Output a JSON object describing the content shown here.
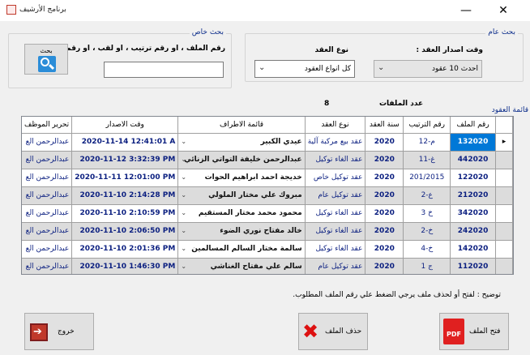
{
  "window": {
    "title": "برنامج الأرشيف",
    "minimize_glyph": "—",
    "close_glyph": "✕"
  },
  "special_search": {
    "title": "بحث خاص",
    "prompt": "رقم الملف ، او رقم ترتيب ، او لقب ، او رقم هاتف :",
    "input_value": "",
    "button_label": "بحث",
    "icon": "search-icon"
  },
  "general_search": {
    "title": "بحث عام",
    "issue_time_label": "وقت اصدار العقد :",
    "issue_time_value": "احدث 10 عقود",
    "contract_type_label": "نوع العقد",
    "contract_type_value": "كل انواع العقود"
  },
  "files_count": {
    "label": "عدد الملفات",
    "value": "8"
  },
  "contracts_list_label": "قائمة العقود",
  "grid": {
    "columns": [
      "رقم الملف",
      "رقم الترتيب",
      "سنة العقد",
      "نوع العقد",
      "قائمة الاطراف",
      "وقت الاصدار",
      "تحرير الموظف"
    ],
    "rows": [
      {
        "file": "132020",
        "seq": "م-12",
        "year": "2020",
        "type": "عقد بيع مركبة آلية",
        "parties": "عيدي الكبير",
        "date": "2020-11-14 12:41:01 A",
        "editor": "عبدالرحمن الع"
      },
      {
        "file": "442020",
        "seq": "غ-11",
        "year": "2020",
        "type": "عقد الغاء توكيل",
        "parties": "عبدالرحمن خليفة التواتي الزنائي",
        "date": "2020-11-12 3:32:39 PM",
        "editor": "عبدالرحمن الع"
      },
      {
        "file": "122020",
        "seq": "201/2015",
        "year": "2020",
        "type": "عقد توكيل خاص",
        "parties": "خديجة احمد ابراهيم الحوات",
        "date": "2020-11-11 12:01:00 PM",
        "editor": "عبدالرحمن الع"
      },
      {
        "file": "212020",
        "seq": "ع-2",
        "year": "2020",
        "type": "عقد توكيل عام",
        "parties": "مبروك علي مختار الملولي",
        "date": "2020-11-10 2:14:28 PM",
        "editor": "عبدالرحمن الع"
      },
      {
        "file": "342020",
        "seq": "خ 3",
        "year": "2020",
        "type": "عقد الغاء توكيل",
        "parties": "محمود محمد مختار المستقيم",
        "date": "2020-11-10 2:10:59 PM",
        "editor": "عبدالرحمن الع"
      },
      {
        "file": "242020",
        "seq": "خ-2",
        "year": "2020",
        "type": "عقد الغاء توكيل",
        "parties": "خالد مفتاح نوري الضوء",
        "date": "2020-11-10 2:06:50 PM",
        "editor": "عبدالرحمن الع"
      },
      {
        "file": "142020",
        "seq": "4-خ",
        "year": "2020",
        "type": "عقد الغاء توكيل",
        "parties": "سالمة مختار السالم المسالمين",
        "date": "2020-11-10 2:01:36 PM",
        "editor": "عبدالرحمن الع"
      },
      {
        "file": "112020",
        "seq": "1 ج",
        "year": "2020",
        "type": "عقد توكيل عام",
        "parties": "سالم علي مفتاح الغناشي",
        "date": "2020-11-10 1:46:30 PM",
        "editor": "عبدالرحمن الع"
      }
    ]
  },
  "hint": "توضيح : لفتح أو لحذف ملف يرجي الضغط علي رقم الملف المطلوب.",
  "buttons": {
    "exit": "خروج",
    "delete": "حذف الملف",
    "open": "فتح الملف",
    "pdf_glyph": "PDF"
  },
  "colors": {
    "selection": "#0078d7",
    "group_title": "#0b2c8a",
    "grid_text": "#0b1f80"
  }
}
